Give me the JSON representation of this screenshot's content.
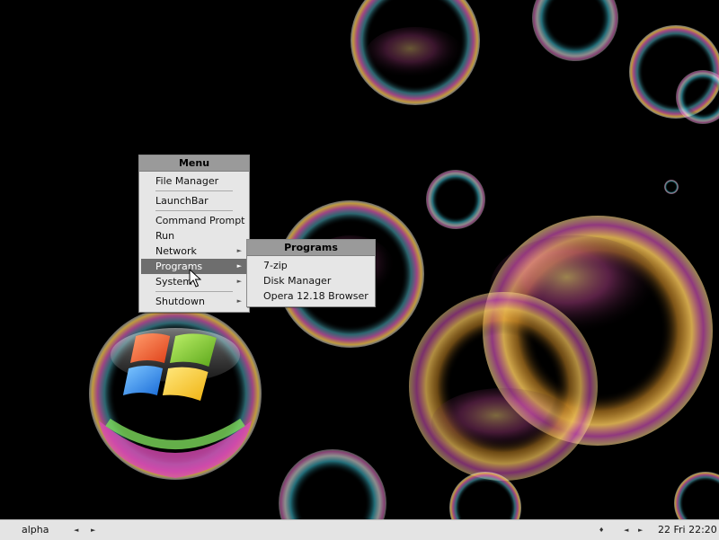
{
  "menu": {
    "title": "Menu",
    "items": [
      {
        "label": "File Manager"
      },
      {
        "label": "LaunchBar"
      },
      {
        "label": "Command Prompt"
      },
      {
        "label": "Run"
      },
      {
        "label": "Network",
        "arrow": "►"
      },
      {
        "label": "Programs",
        "arrow": "►"
      },
      {
        "label": "System",
        "arrow": "►"
      },
      {
        "label": "Shutdown",
        "arrow": "►"
      }
    ]
  },
  "programs_menu": {
    "title": "Programs",
    "items": [
      {
        "label": "7-zip"
      },
      {
        "label": "Disk Manager"
      },
      {
        "label": "Opera 12.18 Browser"
      }
    ]
  },
  "taskbar": {
    "workspace": "alpha",
    "prev_arrow": "◄",
    "next_arrow": "►",
    "tray_dot": "♦",
    "tray_prev": "◄",
    "tray_next": "►",
    "clock": "22 Fri 22:20"
  },
  "colors": {
    "menu_bg": "#e6e6e6",
    "menu_title_bg": "#9a9a9a",
    "highlight_bg": "#6e6e6e",
    "taskbar_bg": "#e4e4e4",
    "desktop_bg": "#000000"
  }
}
